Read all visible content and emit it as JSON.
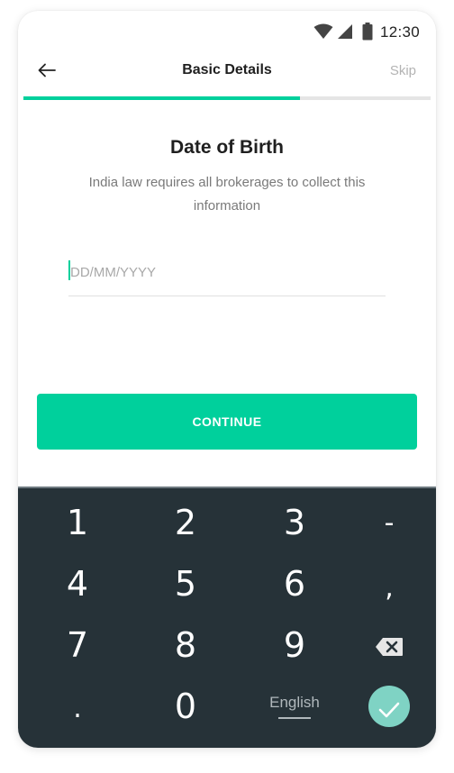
{
  "status_bar": {
    "time": "12:30",
    "icons": [
      "wifi-icon",
      "signal-icon",
      "battery-icon"
    ]
  },
  "header": {
    "back_icon": "arrow-left-icon",
    "title": "Basic Details",
    "skip_label": "Skip",
    "progress_fraction": 0.68
  },
  "form": {
    "title": "Date of Birth",
    "subtitle": "India law requires all brokerages to collect this information",
    "dob_placeholder": "DD/MM/YYYY",
    "dob_value": "",
    "continue_label": "CONTINUE"
  },
  "keyboard": {
    "rows": [
      [
        "1",
        "2",
        "3",
        "-"
      ],
      [
        "4",
        "5",
        "6",
        ","
      ],
      [
        "7",
        "8",
        "9",
        "backspace"
      ],
      [
        ".",
        "0",
        "English",
        "done"
      ]
    ],
    "language_label": "English",
    "backspace_icon": "backspace-icon",
    "done_icon": "check-icon"
  },
  "colors": {
    "accent": "#00d09c",
    "keyboard_bg": "#263238",
    "done_button": "#7fd3c4",
    "progress_track": "#e5e5e5"
  }
}
